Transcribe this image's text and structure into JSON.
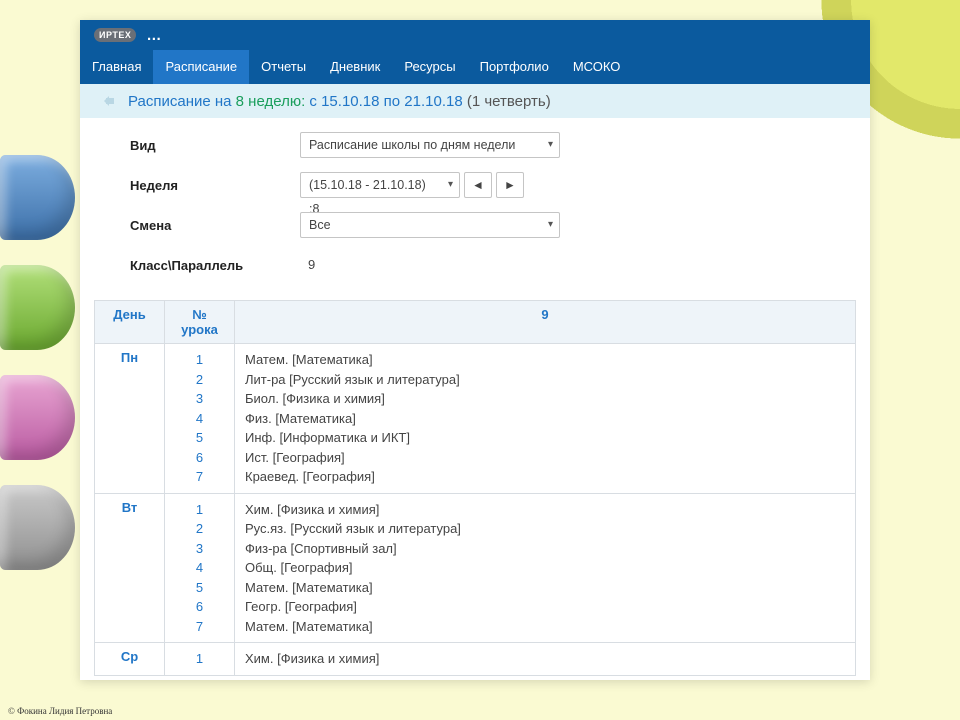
{
  "branding": {
    "logo": "ИРТЕХ",
    "title": "…"
  },
  "nav": {
    "items": [
      "Главная",
      "Расписание",
      "Отчеты",
      "Дневник",
      "Ресурсы",
      "Портфолио",
      "МСОКО"
    ],
    "active_index": 1
  },
  "subheader": {
    "part1": "Расписание на ",
    "week_num": "8 неделю: ",
    "range": "с 15.10.18 по 21.10.18 ",
    "quarter": "(1 четверть)"
  },
  "filters": {
    "view": {
      "label": "Вид",
      "value": "Расписание школы по дням недели"
    },
    "week": {
      "label": "Неделя",
      "value": "(15.10.18 - 21.10.18) :8"
    },
    "shift": {
      "label": "Смена",
      "value": "Все"
    },
    "class": {
      "label": "Класс\\Параллель",
      "value": "9"
    }
  },
  "table": {
    "headers": {
      "day": "День",
      "lesson": "№ урока",
      "class": "9"
    },
    "rows": [
      {
        "day": "Пн",
        "nums": [
          1,
          2,
          3,
          4,
          5,
          6,
          7
        ],
        "items": [
          "Матем. [Математика]",
          "Лит-ра [Русский язык и литература]",
          "Биол. [Физика и химия]",
          "Физ. [Математика]",
          "Инф. [Информатика и ИКТ]",
          "Ист. [География]",
          "Краевед. [География]"
        ]
      },
      {
        "day": "Вт",
        "nums": [
          1,
          2,
          3,
          4,
          5,
          6,
          7
        ],
        "items": [
          "Хим. [Физика и химия]",
          "Рус.яз. [Русский язык и литература]",
          "Физ-ра [Спортивный зал]",
          "Общ. [География]",
          "Матем. [Математика]",
          "Геогр. [География]",
          "Матем. [Математика]"
        ]
      },
      {
        "day": "Ср",
        "nums": [
          1
        ],
        "items": [
          "Хим. [Физика и химия]"
        ]
      }
    ]
  },
  "credit": "© Фокина Лидия Петровна"
}
